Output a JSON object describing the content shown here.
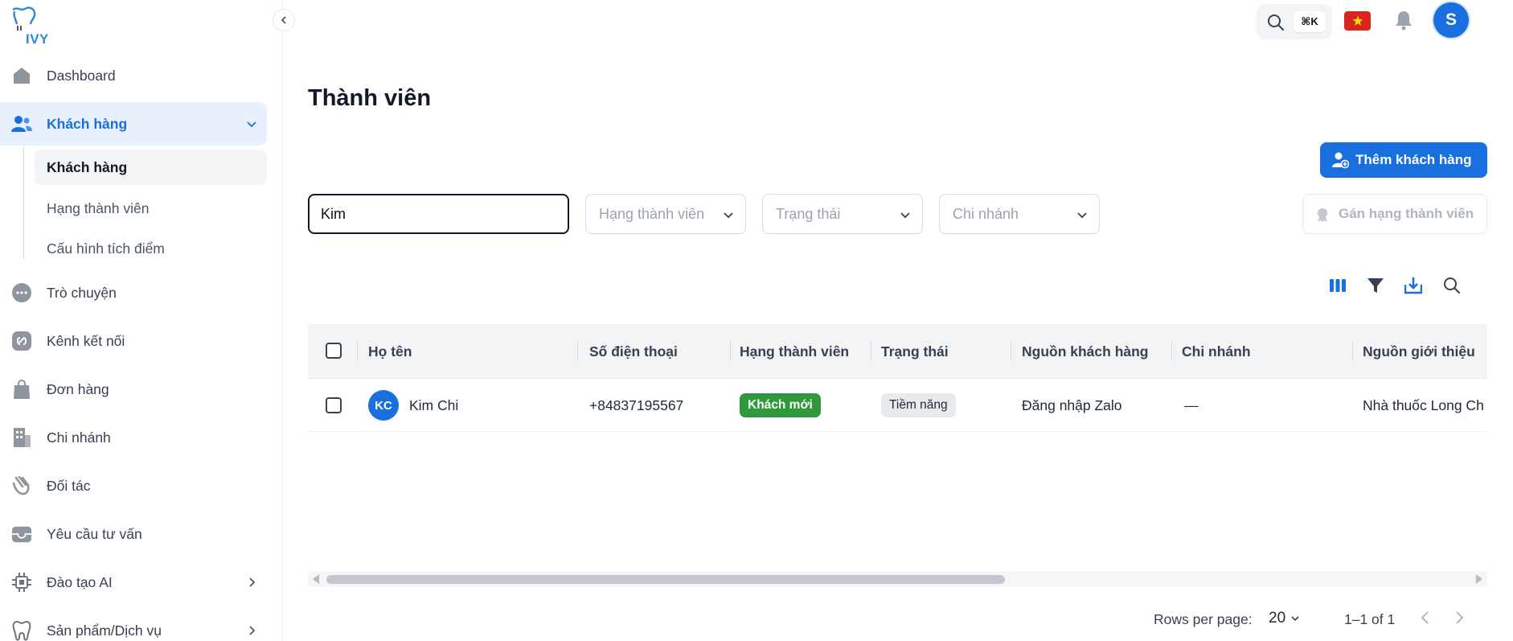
{
  "brand": {
    "logo_text": "IVY"
  },
  "colors": {
    "primary": "#1a6fdf",
    "success": "#2e9a3c",
    "flag_red": "#da251d",
    "flag_star": "#ffde00"
  },
  "sidebar": {
    "items": [
      {
        "label": "Dashboard",
        "icon": "home-icon"
      },
      {
        "label": "Khách hàng",
        "icon": "users-icon",
        "expanded": true
      },
      {
        "label": "Trò chuyện",
        "icon": "chat-icon"
      },
      {
        "label": "Kênh kết nối",
        "icon": "link-icon"
      },
      {
        "label": "Đơn hàng",
        "icon": "bag-icon"
      },
      {
        "label": "Chi nhánh",
        "icon": "building-icon"
      },
      {
        "label": "Đối tác",
        "icon": "handshake-icon"
      },
      {
        "label": "Yêu cầu tư vấn",
        "icon": "inbox-icon"
      },
      {
        "label": "Đào tạo AI",
        "icon": "chip-icon"
      },
      {
        "label": "Sản phẩm/Dịch vụ",
        "icon": "tooth-icon"
      }
    ],
    "sub_items": [
      {
        "label": "Khách hàng"
      },
      {
        "label": "Hạng thành viên"
      },
      {
        "label": "Cấu hình tích điểm"
      }
    ]
  },
  "topbar": {
    "shortcut": "⌘K",
    "user_initial": "S"
  },
  "page": {
    "title": "Thành viên",
    "add_button": "Thêm khách hàng",
    "assign_button": "Gán hạng thành viên"
  },
  "filters": {
    "search_value": "Kim",
    "membership_placeholder": "Hạng thành viên",
    "status_placeholder": "Trạng thái",
    "branch_placeholder": "Chi nhánh"
  },
  "table": {
    "columns": [
      "Họ tên",
      "Số điện thoại",
      "Hạng thành viên",
      "Trạng thái",
      "Nguồn khách hàng",
      "Chi nhánh",
      "Nguồn giới thiệu"
    ],
    "rows": [
      {
        "initials": "KC",
        "name": "Kim Chi",
        "phone": "+84837195567",
        "membership": "Khách mới",
        "status": "Tiềm năng",
        "source": "Đăng nhập Zalo",
        "branch": "—",
        "referral": "Nhà thuốc Long Ch"
      }
    ]
  },
  "pagination": {
    "rows_per_page_label": "Rows per page:",
    "rows_per_page": "20",
    "range": "1–1 of 1"
  }
}
